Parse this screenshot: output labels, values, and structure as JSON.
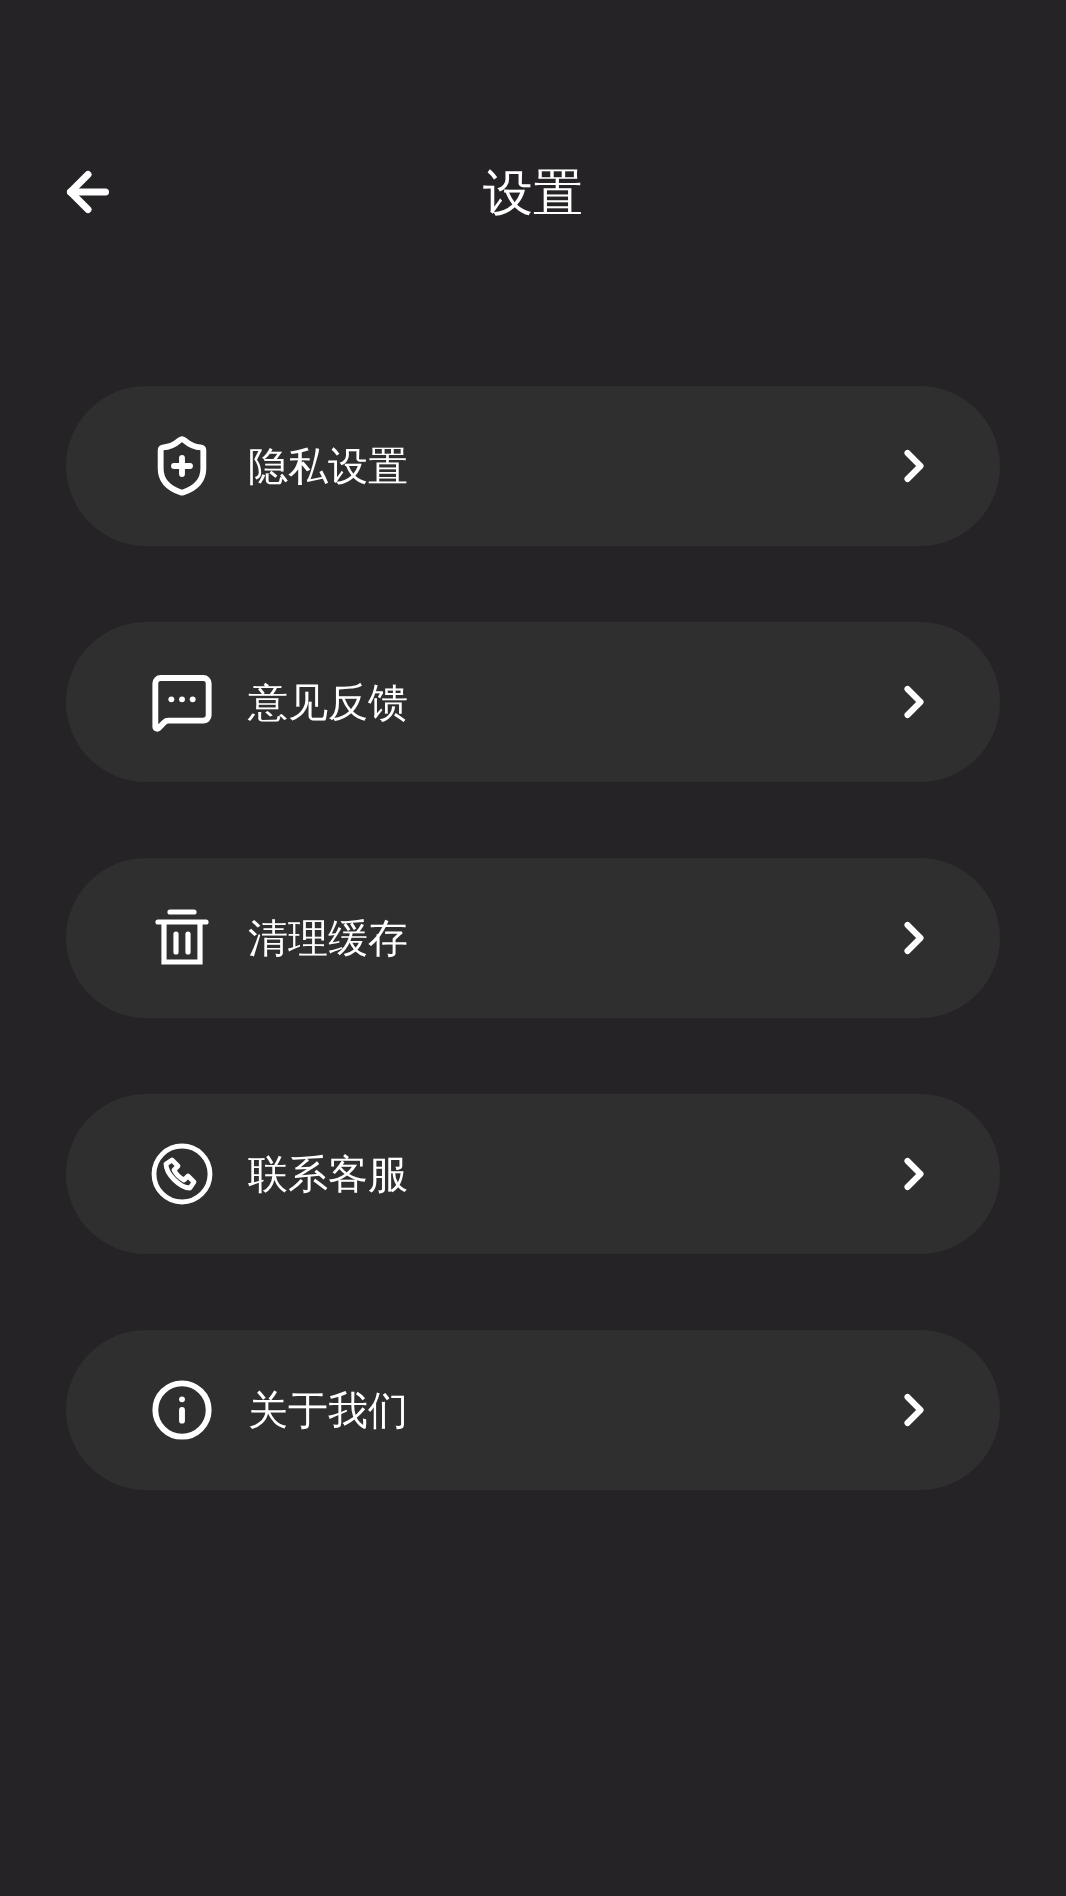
{
  "header": {
    "title": "设置"
  },
  "items": [
    {
      "kind": "privacy",
      "label": "隐私设置"
    },
    {
      "kind": "feedback",
      "label": "意见反馈"
    },
    {
      "kind": "cache",
      "label": "清理缓存"
    },
    {
      "kind": "contact",
      "label": "联系客服"
    },
    {
      "kind": "about",
      "label": "关于我们"
    }
  ]
}
